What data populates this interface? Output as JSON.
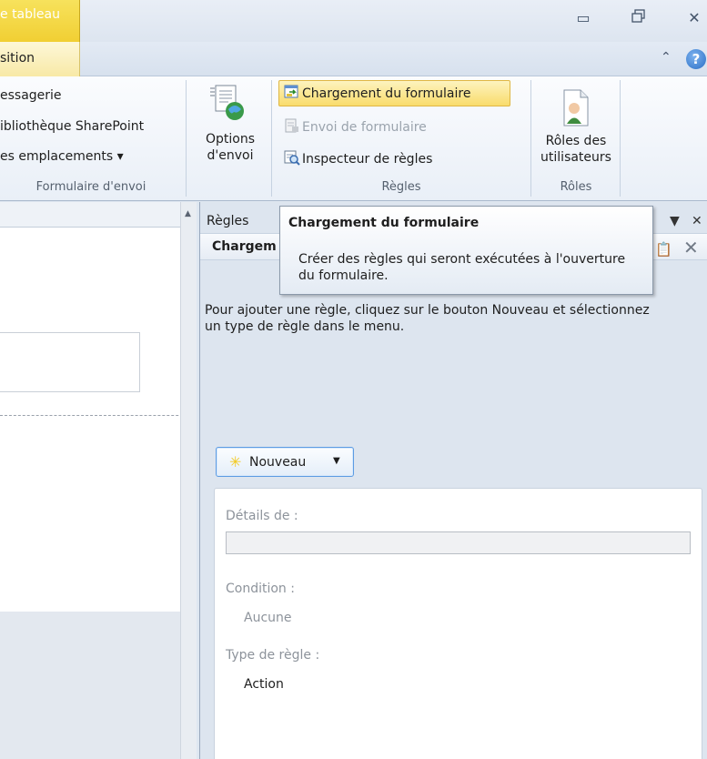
{
  "titlebar": {
    "context_tab": "e tableau",
    "window_controls": {
      "minimize_icon": "minimize-icon",
      "restore_icon": "restore-icon",
      "close_icon": "close-icon"
    }
  },
  "tabs": {
    "active_label": "sition"
  },
  "ribbon": {
    "groups": {
      "submit": {
        "label": "Formulaire d'envoi",
        "items": [
          "essagerie",
          "ibliothèque SharePoint",
          "es emplacements ▾"
        ]
      },
      "options": {
        "label_line1": "Options",
        "label_line2": "d'envoi"
      },
      "rules": {
        "label": "Règles",
        "form_load": "Chargement du formulaire",
        "form_submit": "Envoi de formulaire",
        "rule_inspector": "Inspecteur de règles"
      },
      "roles": {
        "label": "Rôles",
        "button_line1": "Rôles des",
        "button_line2": "utilisateurs"
      }
    }
  },
  "task_pane": {
    "title": "Règles",
    "subtitle": "Chargem",
    "message": "Pour ajouter une règle, cliquez sur le bouton Nouveau et sélectionnez un type de règle dans le menu.",
    "new_button": "Nouveau",
    "details": {
      "details_label": "Détails de :",
      "details_value": "",
      "condition_label": "Condition :",
      "condition_value": "Aucune",
      "rule_type_label": "Type de règle :",
      "rule_type_value": "Action"
    }
  },
  "tooltip": {
    "title": "Chargement du formulaire",
    "body": "Créer des règles qui seront exécutées à l'ouverture du formulaire."
  },
  "colors": {
    "accent_gold": "#f1cf33",
    "highlight": "#f9dc6c",
    "pane_bg": "#dde5ef",
    "button_border": "#5d9ce3"
  }
}
